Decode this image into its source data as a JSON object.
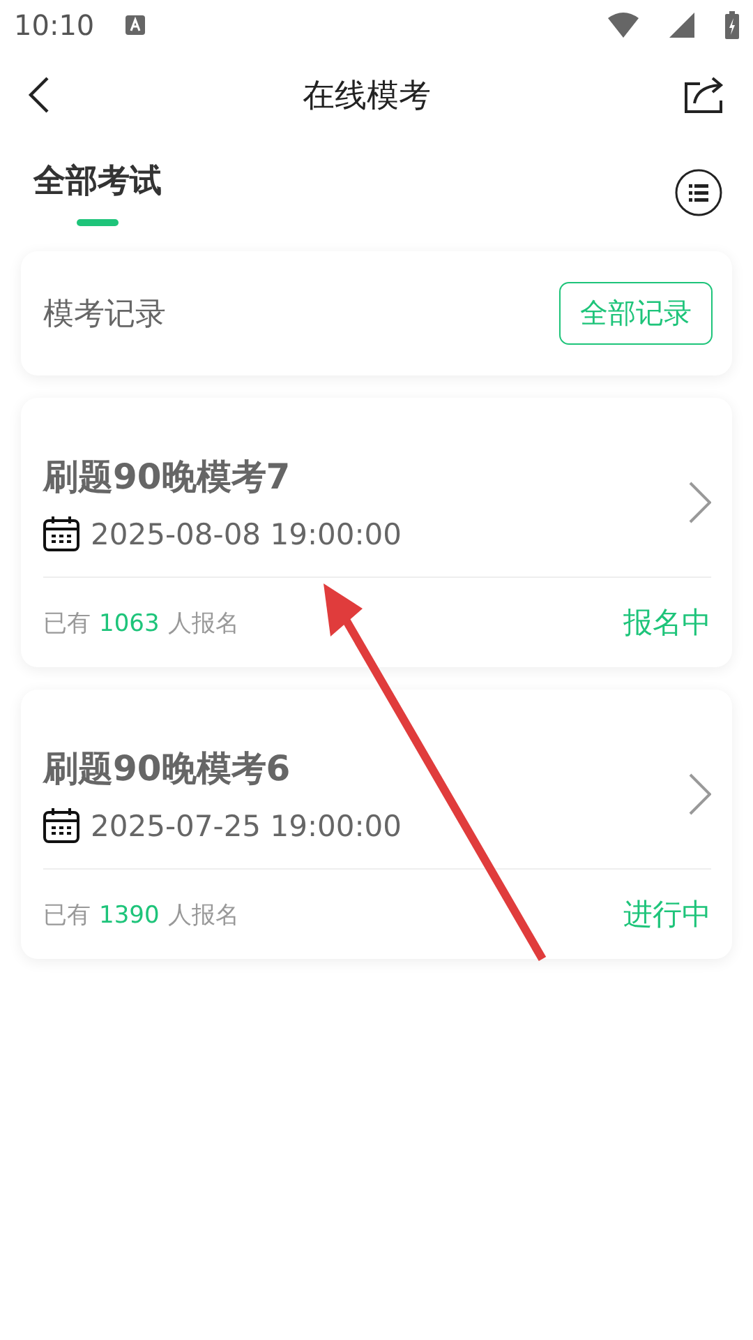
{
  "status_bar": {
    "time": "10:10"
  },
  "header": {
    "title": "在线模考"
  },
  "tabs": [
    {
      "label": "全部考试",
      "selected": true
    }
  ],
  "records": {
    "label": "模考记录",
    "button": "全部记录"
  },
  "exams": [
    {
      "title": "刷题90晚模考7",
      "date": "2025-08-08 19:00:00",
      "prefix": "已有",
      "count": "1063",
      "suffix": "人报名",
      "status": "报名中"
    },
    {
      "title": "刷题90晚模考6",
      "date": "2025-07-25 19:00:00",
      "prefix": "已有",
      "count": "1390",
      "suffix": "人报名",
      "status": "进行中"
    }
  ],
  "annotation": {
    "kind": "arrow"
  }
}
